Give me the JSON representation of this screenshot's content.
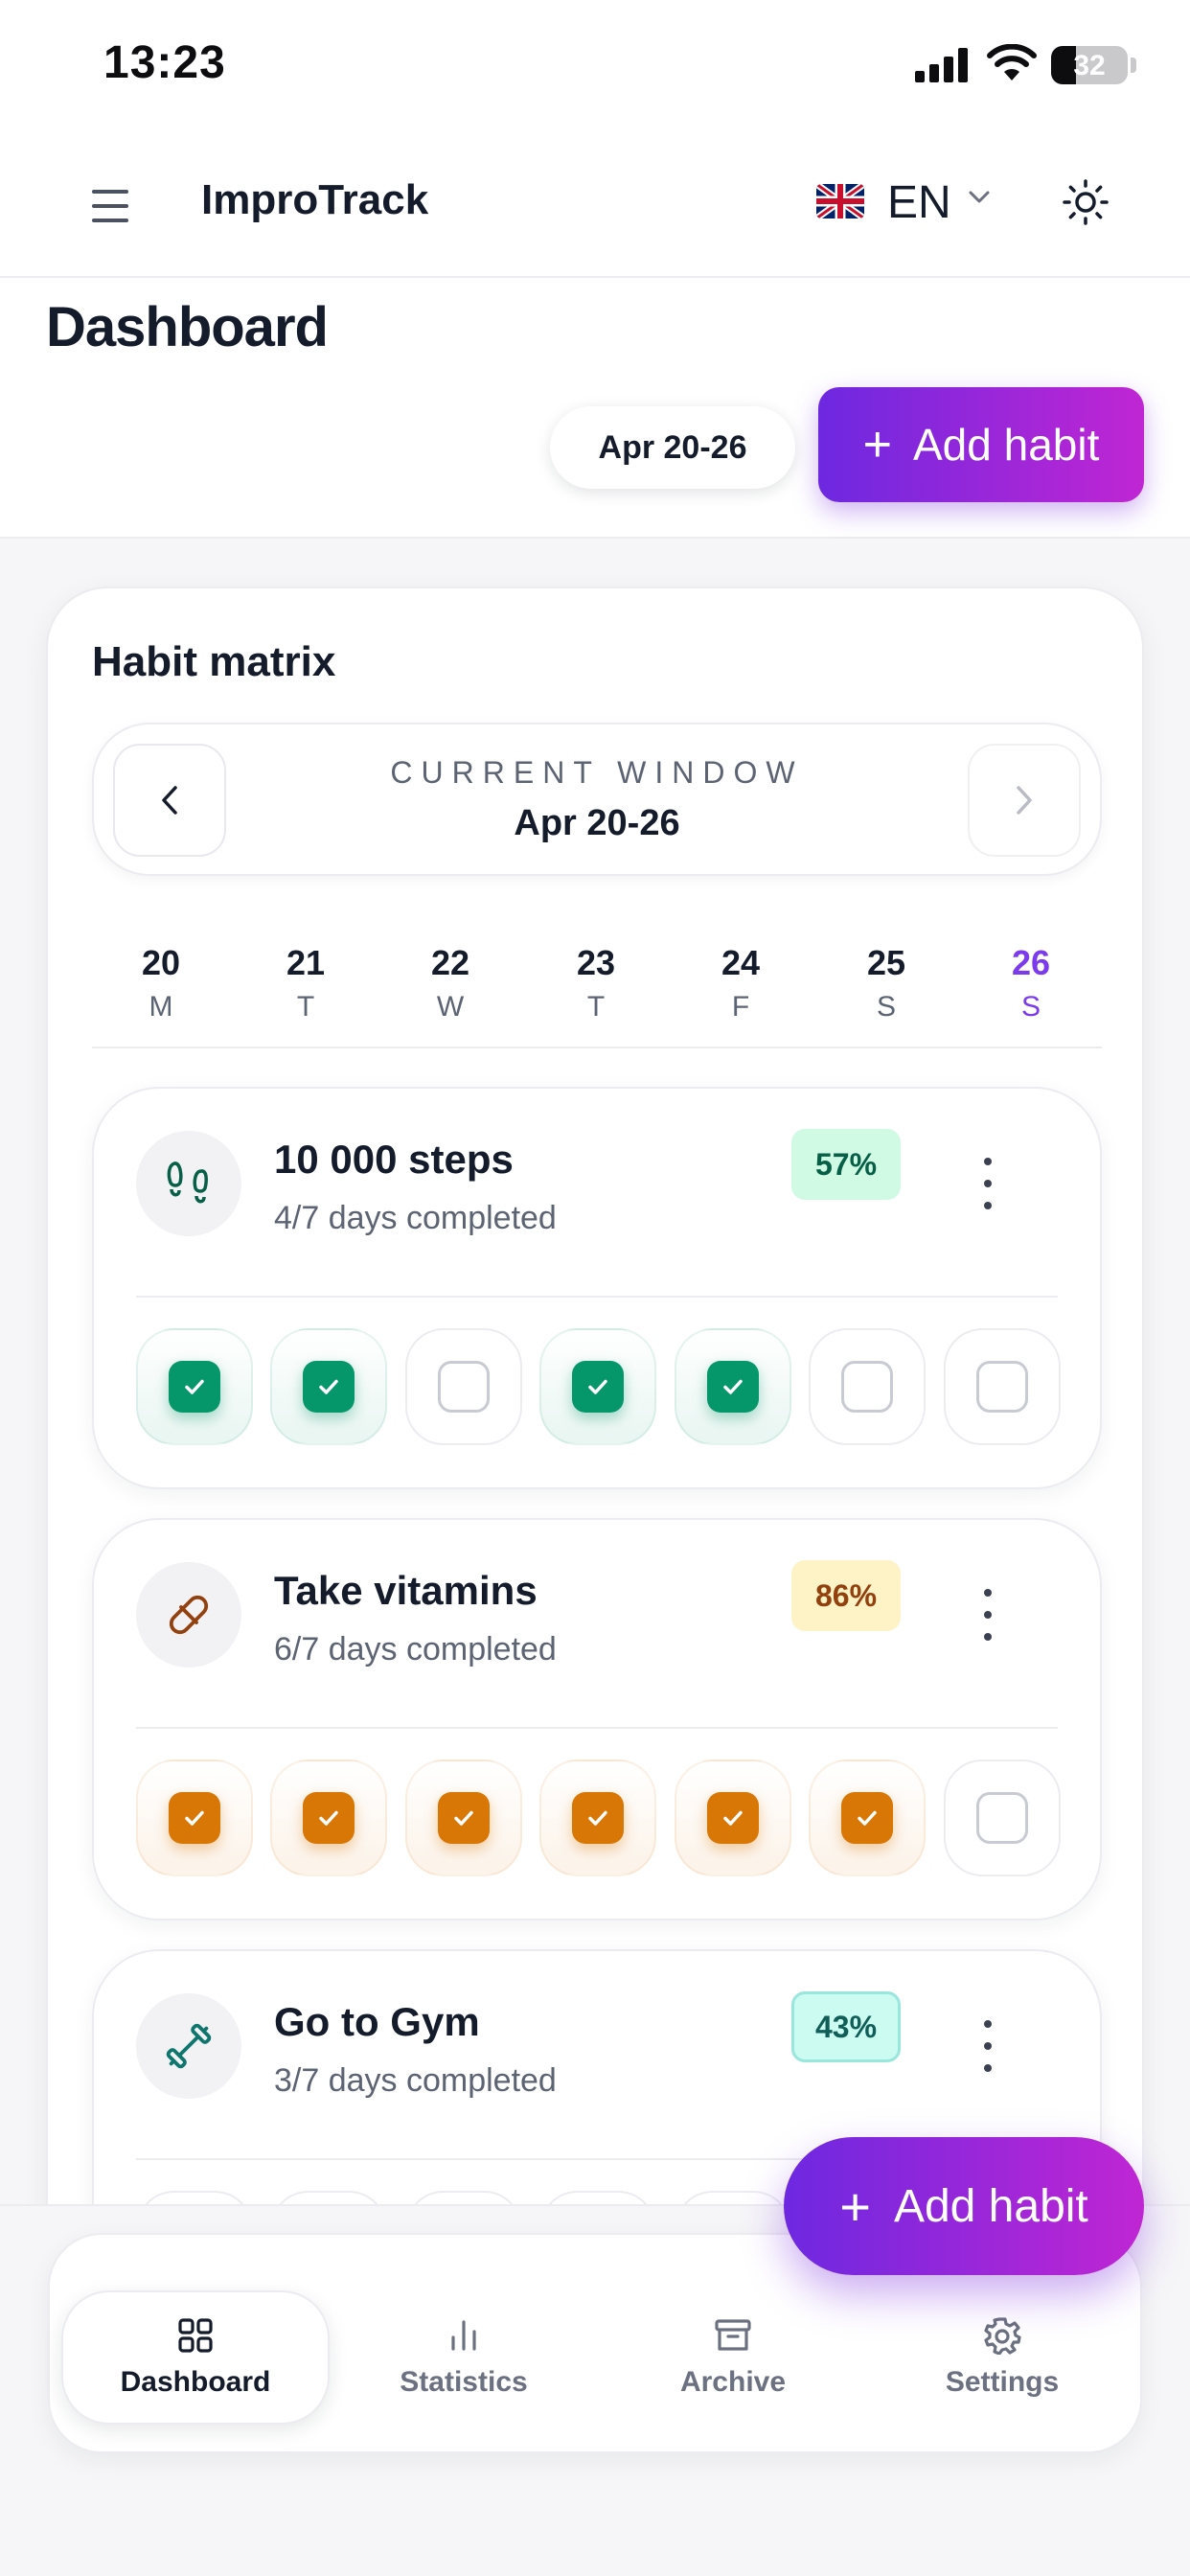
{
  "status_bar": {
    "time": "13:23",
    "battery": "32",
    "battery_level": 0.32
  },
  "header": {
    "app_title": "ImproTrack",
    "language_code": "EN"
  },
  "page": {
    "title": "Dashboard",
    "date_range": "Apr 20-26",
    "add_habit_label": "Add habit"
  },
  "matrix": {
    "title": "Habit matrix",
    "window_label": "CURRENT WINDOW",
    "window_range": "Apr 20-26",
    "days": [
      {
        "num": "20",
        "weekday": "M"
      },
      {
        "num": "21",
        "weekday": "T"
      },
      {
        "num": "22",
        "weekday": "W"
      },
      {
        "num": "23",
        "weekday": "T"
      },
      {
        "num": "24",
        "weekday": "F"
      },
      {
        "num": "25",
        "weekday": "S"
      },
      {
        "num": "26",
        "weekday": "S"
      }
    ],
    "today_index": 6
  },
  "habits": [
    {
      "name": "10 000 steps",
      "progress": "4/7 days completed",
      "percent": "57%",
      "icon": "footprints-icon",
      "color": "#059669",
      "badge_bg": "#d1fae5",
      "badge_fg": "#065f46",
      "checks": [
        true,
        true,
        false,
        true,
        true,
        false,
        false
      ]
    },
    {
      "name": "Take vitamins",
      "progress": "6/7 days completed",
      "percent": "86%",
      "icon": "pill-icon",
      "color": "#d97706",
      "badge_bg": "#fef3c7",
      "badge_fg": "#92400e",
      "checks": [
        true,
        true,
        true,
        true,
        true,
        true,
        false
      ]
    },
    {
      "name": "Go to Gym",
      "progress": "3/7 days completed",
      "percent": "43%",
      "icon": "dumbbell-icon",
      "color": "#0f9488",
      "badge_bg": "#ccfbf1",
      "badge_fg": "#115e59",
      "checks": [
        false,
        false,
        false,
        false,
        false,
        false,
        false
      ]
    }
  ],
  "fab": {
    "label": "Add habit"
  },
  "tabs": [
    {
      "label": "Dashboard",
      "icon": "grid-icon",
      "active": true
    },
    {
      "label": "Statistics",
      "icon": "bar-chart-icon",
      "active": false
    },
    {
      "label": "Archive",
      "icon": "archive-icon",
      "active": false
    },
    {
      "label": "Settings",
      "icon": "gear-icon",
      "active": false
    }
  ]
}
